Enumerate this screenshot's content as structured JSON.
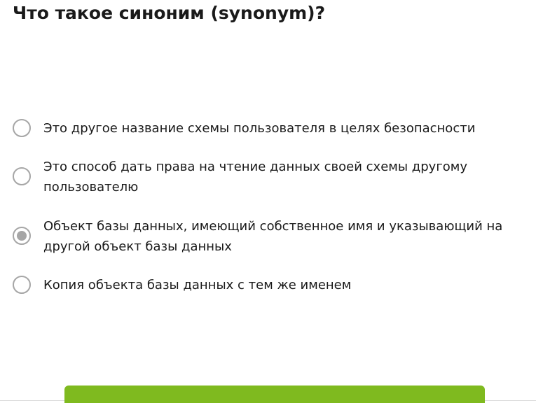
{
  "question": {
    "title": "Что такое синоним (synonym)?"
  },
  "options": [
    {
      "label": "Это другое название схемы пользователя в целях безопасности",
      "selected": false
    },
    {
      "label": "Это способ дать права на чтение данных своей схемы другому пользователю",
      "selected": false
    },
    {
      "label": "Объект базы данных, имеющий собственное имя и указывающий на другой объект базы данных",
      "selected": true
    },
    {
      "label": "Копия объекта базы данных с тем же именем",
      "selected": false
    }
  ],
  "actions": {
    "submit_label": ""
  }
}
